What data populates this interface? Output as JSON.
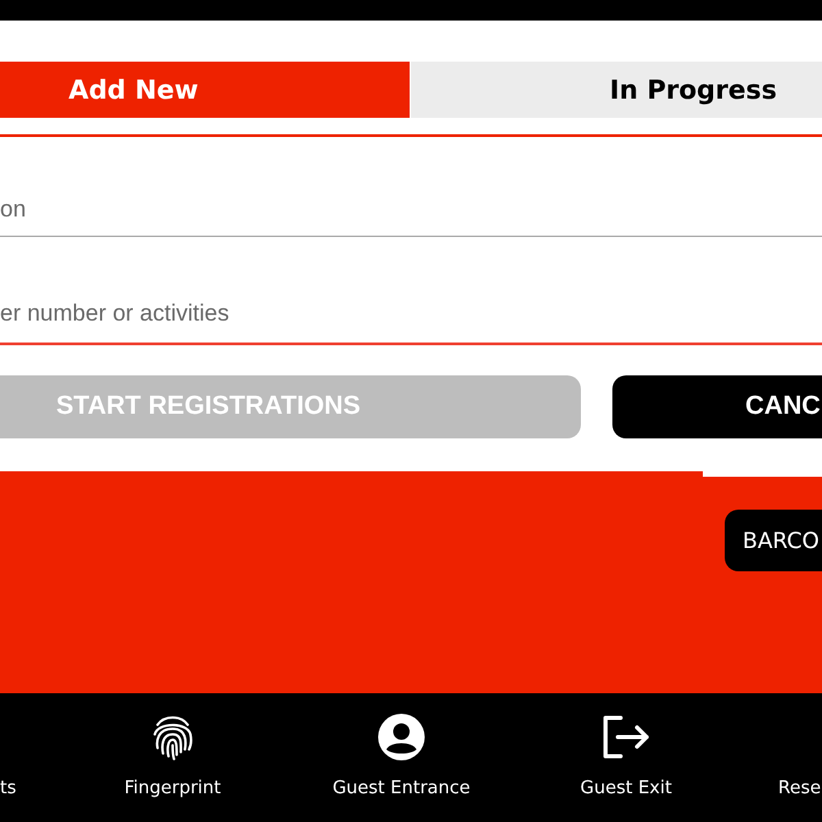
{
  "tabs": [
    {
      "label": "Add New",
      "selected": true
    },
    {
      "label": "In Progress",
      "selected": false
    }
  ],
  "fields": [
    {
      "placeholder": "on",
      "focused": false
    },
    {
      "placeholder": "er number or activities",
      "focused": true
    }
  ],
  "buttons": [
    {
      "label": "START REGISTRATIONS",
      "disabled": true
    },
    {
      "label": "CANC",
      "disabled": false
    }
  ],
  "barcode_button": "BARCO",
  "bottom_nav": [
    {
      "label": "ts",
      "kind": "text"
    },
    {
      "label": "Fingerprint",
      "kind": "fingerprint"
    },
    {
      "label": "Guest Entrance",
      "kind": "person"
    },
    {
      "label": "Guest Exit",
      "kind": "exit"
    },
    {
      "label": "Rese",
      "kind": "text"
    }
  ]
}
